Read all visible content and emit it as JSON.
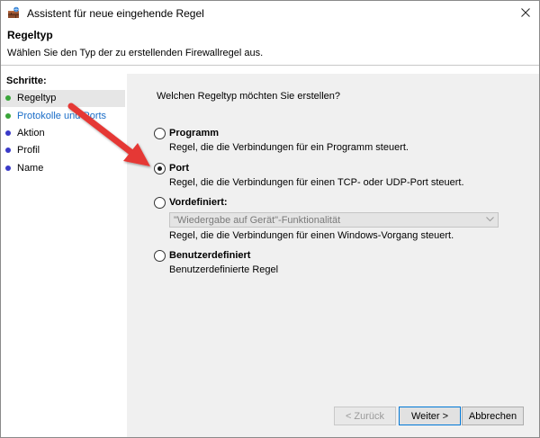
{
  "window": {
    "title": "Assistent für neue eingehende Regel"
  },
  "header": {
    "title": "Regeltyp",
    "subtitle": "Wählen Sie den Typ der zu erstellenden Firewallregel aus."
  },
  "sidebar": {
    "title": "Schritte:",
    "items": [
      {
        "label": "Regeltyp",
        "dot_color": "#3aa53a",
        "active": true
      },
      {
        "label": "Protokolle und Ports",
        "dot_color": "#3aa53a",
        "active": false
      },
      {
        "label": "Aktion",
        "dot_color": "#3a3ac8",
        "active": false
      },
      {
        "label": "Profil",
        "dot_color": "#3a3ac8",
        "active": false
      },
      {
        "label": "Name",
        "dot_color": "#3a3ac8",
        "active": false
      }
    ]
  },
  "main": {
    "question": "Welchen Regeltyp möchten Sie erstellen?",
    "options": [
      {
        "label": "Programm",
        "description": "Regel, die die Verbindungen für ein Programm steuert.",
        "checked": false
      },
      {
        "label": "Port",
        "description": "Regel, die die Verbindungen für einen TCP- oder UDP-Port steuert.",
        "checked": true
      },
      {
        "label": "Vordefiniert:",
        "description": "Regel, die die Verbindungen für einen Windows-Vorgang steuert.",
        "checked": false
      },
      {
        "label": "Benutzerdefiniert",
        "description": "Benutzerdefinierte Regel",
        "checked": false
      }
    ],
    "predefined_select": {
      "value": "\"Wiedergabe auf Gerät\"-Funktionalität"
    }
  },
  "footer": {
    "back_label": "< Zurück",
    "next_label": "Weiter >",
    "cancel_label": "Abbrechen"
  },
  "colors": {
    "annotation_arrow": "#e53935",
    "link": "#1a6dc8"
  }
}
